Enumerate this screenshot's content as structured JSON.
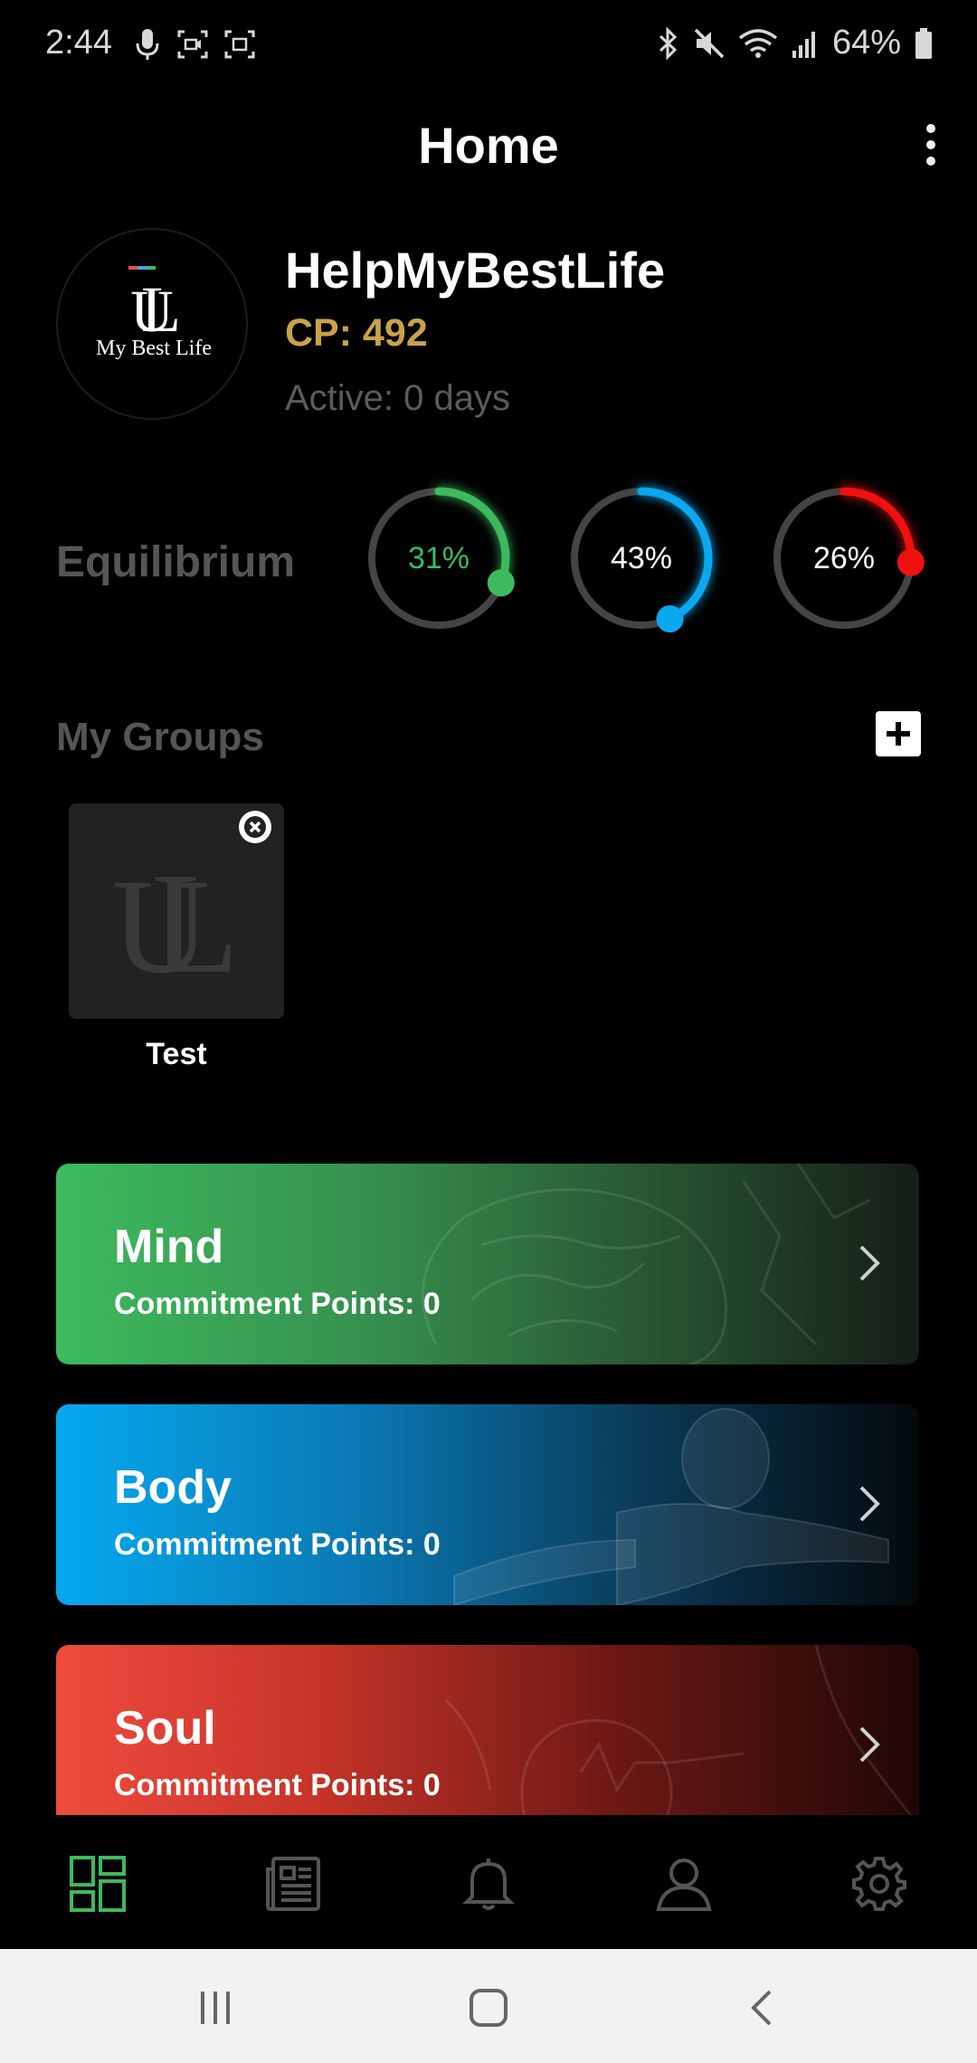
{
  "status_bar": {
    "time": "2:44",
    "battery": "64%",
    "left_icons": [
      "mic-icon",
      "screen-record-icon",
      "screen-capture-icon"
    ],
    "right_icons": [
      "bluetooth-icon",
      "mute-icon",
      "wifi-icon",
      "signal-icon",
      "battery-icon"
    ]
  },
  "app_bar": {
    "title": "Home",
    "menu_icon": "more-vertical-icon"
  },
  "profile": {
    "avatar_brand": "My Best Life",
    "name": "HelpMyBestLife",
    "cp": "CP: 492",
    "active": "Active: 0 days"
  },
  "equilibrium": {
    "label": "Equilibrium",
    "gauges": [
      {
        "value": 0.31,
        "label": "31%",
        "color": "#3dba5e",
        "text_color": "#3dba5e"
      },
      {
        "value": 0.43,
        "label": "43%",
        "color": "#0aa8ef",
        "text_color": "#ffffff"
      },
      {
        "value": 0.26,
        "label": "26%",
        "color": "#f01010",
        "text_color": "#ffffff"
      }
    ],
    "track_color": "#444444"
  },
  "groups": {
    "label": "My Groups",
    "add_icon": "plus-icon",
    "items": [
      {
        "name": "Test",
        "remove_icon": "close-icon"
      }
    ]
  },
  "categories": [
    {
      "title": "Mind",
      "subtitle": "Commitment Points: 0",
      "color": "#3dba5e"
    },
    {
      "title": "Body",
      "subtitle": "Commitment Points: 0",
      "color": "#05a8ef"
    },
    {
      "title": "Soul",
      "subtitle": "Commitment Points: 0",
      "color": "#ef4b3e"
    }
  ],
  "bottom_nav": {
    "items": [
      {
        "icon": "dashboard-icon",
        "active": true
      },
      {
        "icon": "news-icon",
        "active": false
      },
      {
        "icon": "bell-icon",
        "active": false
      },
      {
        "icon": "profile-icon",
        "active": false
      },
      {
        "icon": "gear-icon",
        "active": false
      }
    ],
    "active_color": "#3dba5e",
    "inactive_color": "#555555"
  },
  "system_nav": {
    "items": [
      "recents-icon",
      "home-icon",
      "back-icon"
    ]
  }
}
